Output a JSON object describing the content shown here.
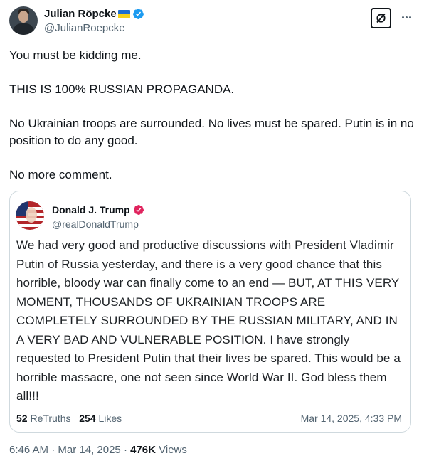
{
  "author": {
    "name": "Julian Röpcke",
    "handle": "@JulianRoepcke",
    "flag_icon": "ukraine-flag-icon",
    "verified_color": "#1d9bf0"
  },
  "actions": {
    "grok_icon": "grok-slash-icon",
    "more_icon": "more-dots-icon"
  },
  "post": {
    "text": "You must be kidding me.\n\nTHIS IS 100% RUSSIAN PROPAGANDA.\n\nNo Ukrainian troops are surrounded. No lives must be spared. Putin is in no position to do any good.\n\nNo more comment."
  },
  "quote": {
    "name": "Donald J. Trump",
    "handle": "@realDonaldTrump",
    "badge_color": "#e0245e",
    "text": "We had very good and productive discussions with President Vladimir Putin of Russia yesterday, and there is a very good chance that this horrible, bloody war can finally come to an end — BUT, AT THIS VERY MOMENT, THOUSANDS OF UKRAINIAN TROOPS ARE COMPLETELY SURROUNDED BY THE RUSSIAN MILITARY, AND IN A VERY BAD AND VULNERABLE POSITION. I have strongly requested to President Putin that their lives be spared. This would be a horrible massacre, one not seen since World War II. God bless them all!!!",
    "retruths_count": "52",
    "retruths_label": "ReTruths",
    "likes_count": "254",
    "likes_label": "Likes",
    "date": "Mar 14, 2025, 4:33 PM"
  },
  "footer": {
    "time": "6:46 AM",
    "sep1": " · ",
    "date": "Mar 14, 2025",
    "sep2": " · ",
    "views_count": "476K",
    "views_label": " Views"
  }
}
